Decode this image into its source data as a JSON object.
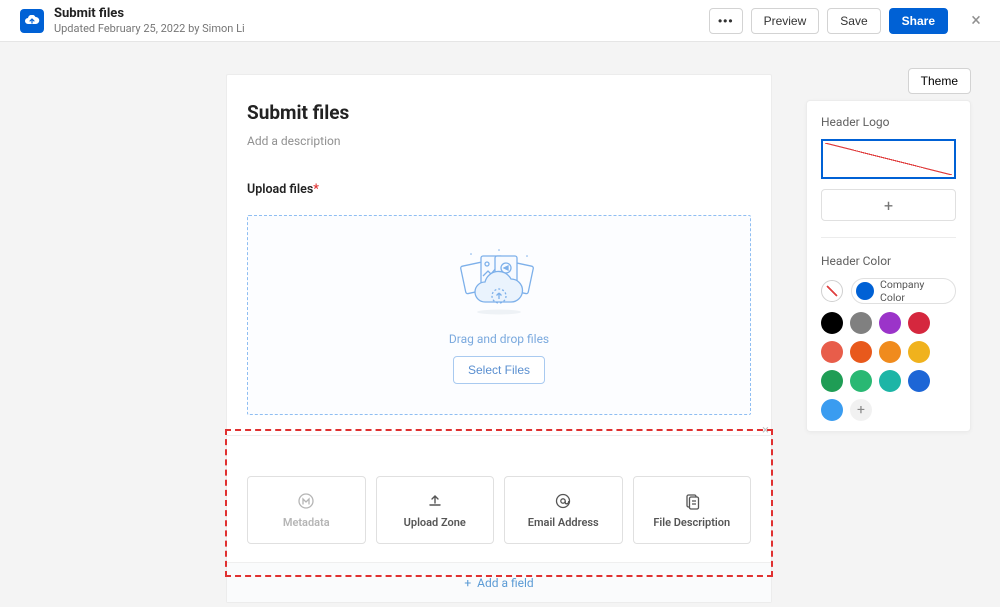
{
  "header": {
    "title": "Submit files",
    "subtitle": "Updated February 25, 2022 by Simon Li",
    "actions": {
      "more": "•••",
      "preview": "Preview",
      "save": "Save",
      "share": "Share"
    }
  },
  "form": {
    "title": "Submit files",
    "desc_placeholder": "Add a description",
    "upload_label": "Upload files",
    "drop_text": "Drag and drop files",
    "select_files": "Select Files",
    "add_field": "Add a field",
    "field_cards": [
      {
        "label": "Metadata",
        "icon": "metadata"
      },
      {
        "label": "Upload Zone",
        "icon": "upload"
      },
      {
        "label": "Email Address",
        "icon": "at"
      },
      {
        "label": "File Description",
        "icon": "file"
      }
    ]
  },
  "side": {
    "theme_btn": "Theme",
    "header_logo_label": "Header Logo",
    "header_color_label": "Header Color",
    "company_color_label": "Company Color",
    "colors": [
      "#000000",
      "#808080",
      "#9b34c9",
      "#d5273e",
      "#e85d4a",
      "#e8591c",
      "#f08b1d",
      "#f0b21d",
      "#1f9d55",
      "#29b873",
      "#1db5a6",
      "#1d66d6",
      "#3a9cf0"
    ]
  }
}
